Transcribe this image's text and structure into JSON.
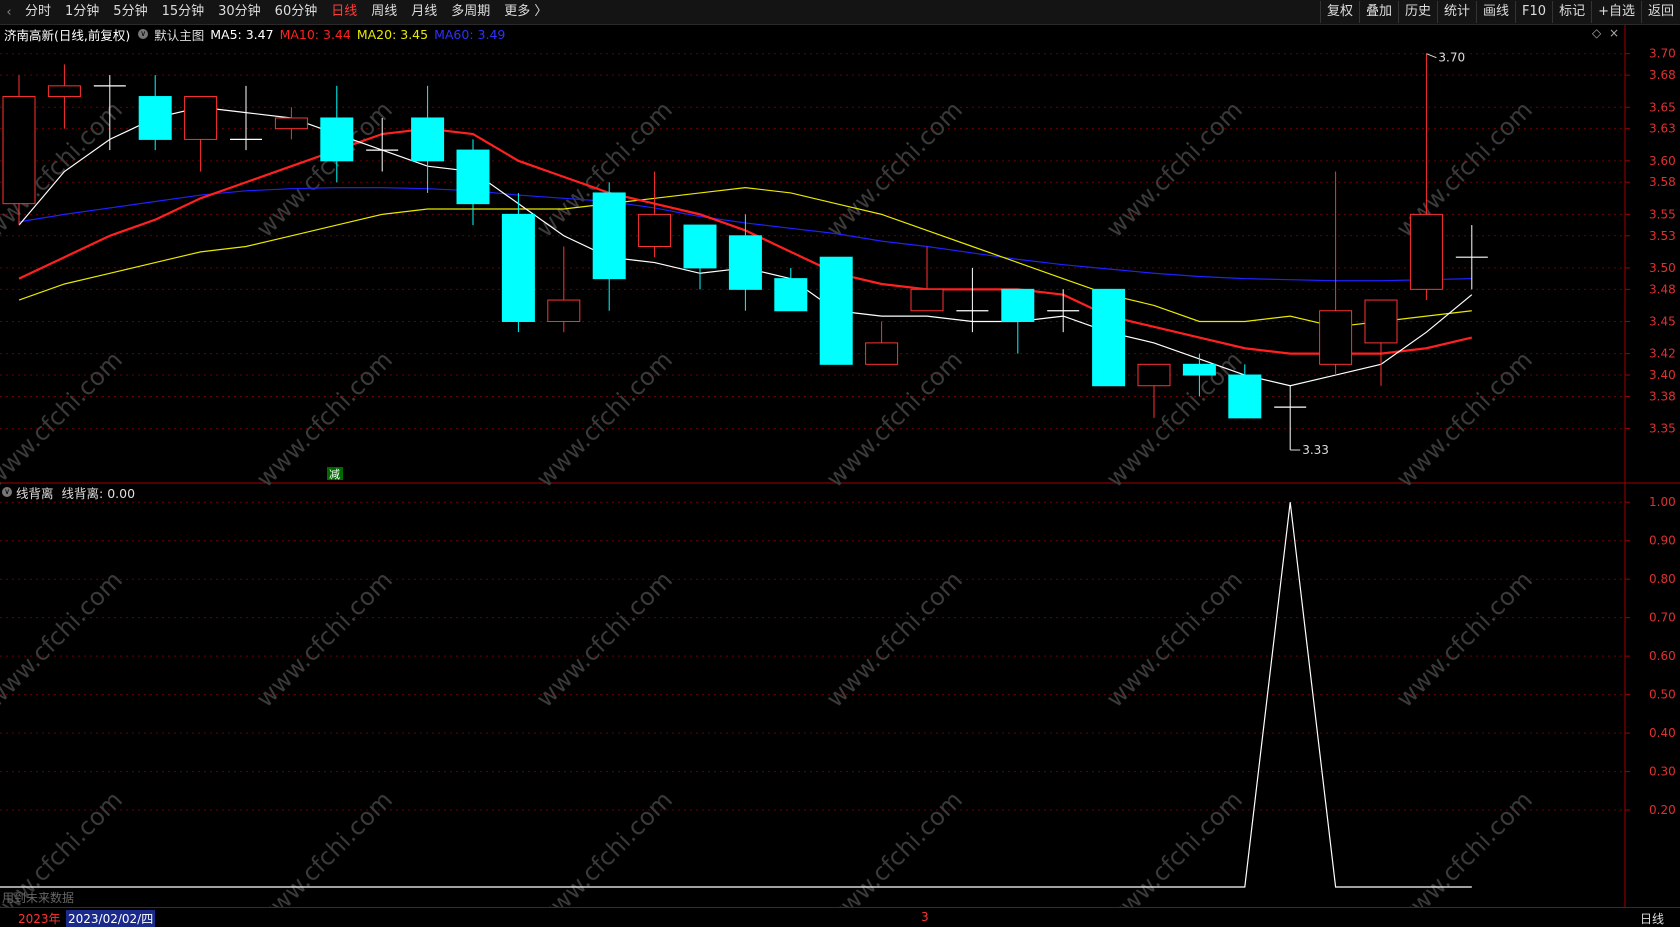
{
  "toolbar": {
    "back_arrow": "‹",
    "periods": [
      "分时",
      "1分钟",
      "5分钟",
      "15分钟",
      "30分钟",
      "60分钟",
      "日线",
      "周线",
      "月线",
      "多周期",
      "更多 〉"
    ],
    "active_period": "日线",
    "right_buttons": [
      "复权",
      "叠加",
      "历史",
      "统计",
      "画线",
      "F10",
      "标记",
      "+自选",
      "返回"
    ]
  },
  "main_info": {
    "stock": "济南高新(日线,前复权)",
    "template": "默认主图",
    "ma5": "MA5: 3.47",
    "ma10": "MA10: 3.44",
    "ma20": "MA20: 3.45",
    "ma60": "MA60: 3.49"
  },
  "sub_info": {
    "indicator": "线背离",
    "value": "线背离: 0.00"
  },
  "markers": {
    "high_label": "3.70",
    "low_label": "3.33",
    "signal": "减",
    "future_note": "用到未来数据"
  },
  "bottom": {
    "year": "2023年",
    "cursor_date": "2023/02/02/四",
    "month_mark": "3",
    "period_label": "日线"
  },
  "price_axis": [
    "3.70",
    "3.68",
    "3.65",
    "3.63",
    "3.60",
    "3.58",
    "3.55",
    "3.53",
    "3.50",
    "3.48",
    "3.45",
    "3.42",
    "3.40",
    "3.38",
    "3.35"
  ],
  "indicator_axis": [
    "1.00",
    "0.90",
    "0.80",
    "0.70",
    "0.60",
    "0.50",
    "0.40",
    "0.30",
    "0.20"
  ],
  "watermark": "www.cfchi.com",
  "colors": {
    "up": "#ff3232",
    "down": "#00ffff",
    "ma5": "#ffffff",
    "ma10": "#ff2020",
    "ma20": "#e8e800",
    "ma60": "#2020ff",
    "axis": "#a00000",
    "active": "#ff3b3b"
  },
  "chart_data": {
    "type": "candlestick",
    "candles": [
      {
        "o": 3.56,
        "h": 3.68,
        "l": 3.54,
        "c": 3.66
      },
      {
        "o": 3.66,
        "h": 3.69,
        "l": 3.63,
        "c": 3.67
      },
      {
        "o": 3.67,
        "h": 3.68,
        "l": 3.61,
        "c": 3.67
      },
      {
        "o": 3.66,
        "h": 3.68,
        "l": 3.61,
        "c": 3.62
      },
      {
        "o": 3.62,
        "h": 3.66,
        "l": 3.59,
        "c": 3.66
      },
      {
        "o": 3.62,
        "h": 3.67,
        "l": 3.61,
        "c": 3.62
      },
      {
        "o": 3.63,
        "h": 3.65,
        "l": 3.62,
        "c": 3.64
      },
      {
        "o": 3.64,
        "h": 3.67,
        "l": 3.58,
        "c": 3.6
      },
      {
        "o": 3.61,
        "h": 3.64,
        "l": 3.59,
        "c": 3.61
      },
      {
        "o": 3.64,
        "h": 3.67,
        "l": 3.57,
        "c": 3.6
      },
      {
        "o": 3.61,
        "h": 3.62,
        "l": 3.54,
        "c": 3.56
      },
      {
        "o": 3.55,
        "h": 3.57,
        "l": 3.44,
        "c": 3.45
      },
      {
        "o": 3.45,
        "h": 3.52,
        "l": 3.44,
        "c": 3.47
      },
      {
        "o": 3.57,
        "h": 3.58,
        "l": 3.46,
        "c": 3.49
      },
      {
        "o": 3.52,
        "h": 3.59,
        "l": 3.51,
        "c": 3.55
      },
      {
        "o": 3.54,
        "h": 3.54,
        "l": 3.48,
        "c": 3.5
      },
      {
        "o": 3.53,
        "h": 3.55,
        "l": 3.46,
        "c": 3.48
      },
      {
        "o": 3.49,
        "h": 3.5,
        "l": 3.46,
        "c": 3.46
      },
      {
        "o": 3.51,
        "h": 3.51,
        "l": 3.41,
        "c": 3.41
      },
      {
        "o": 3.41,
        "h": 3.45,
        "l": 3.41,
        "c": 3.43
      },
      {
        "o": 3.46,
        "h": 3.52,
        "l": 3.46,
        "c": 3.48
      },
      {
        "o": 3.46,
        "h": 3.5,
        "l": 3.44,
        "c": 3.46
      },
      {
        "o": 3.48,
        "h": 3.48,
        "l": 3.42,
        "c": 3.45
      },
      {
        "o": 3.46,
        "h": 3.48,
        "l": 3.44,
        "c": 3.46
      },
      {
        "o": 3.48,
        "h": 3.48,
        "l": 3.39,
        "c": 3.39
      },
      {
        "o": 3.39,
        "h": 3.39,
        "l": 3.36,
        "c": 3.41
      },
      {
        "o": 3.41,
        "h": 3.42,
        "l": 3.38,
        "c": 3.4
      },
      {
        "o": 3.4,
        "h": 3.41,
        "l": 3.36,
        "c": 3.36
      },
      {
        "o": 3.37,
        "h": 3.39,
        "l": 3.33,
        "c": 3.37
      },
      {
        "o": 3.41,
        "h": 3.59,
        "l": 3.4,
        "c": 3.46
      },
      {
        "o": 3.43,
        "h": 3.47,
        "l": 3.39,
        "c": 3.47
      },
      {
        "o": 3.48,
        "h": 3.7,
        "l": 3.47,
        "c": 3.55
      },
      {
        "o": 3.51,
        "h": 3.54,
        "l": 3.48,
        "c": 3.51
      }
    ],
    "ma5": [
      3.54,
      3.59,
      3.62,
      3.64,
      3.65,
      3.645,
      3.64,
      3.625,
      3.61,
      3.595,
      3.59,
      3.56,
      3.53,
      3.51,
      3.505,
      3.495,
      3.5,
      3.49,
      3.46,
      3.455,
      3.455,
      3.45,
      3.45,
      3.455,
      3.44,
      3.43,
      3.415,
      3.4,
      3.39,
      3.4,
      3.41,
      3.44,
      3.475
    ],
    "ma10": [
      3.49,
      3.51,
      3.53,
      3.545,
      3.565,
      3.58,
      3.595,
      3.61,
      3.625,
      3.63,
      3.625,
      3.6,
      3.585,
      3.57,
      3.56,
      3.55,
      3.535,
      3.515,
      3.495,
      3.485,
      3.48,
      3.48,
      3.48,
      3.475,
      3.455,
      3.445,
      3.435,
      3.425,
      3.42,
      3.42,
      3.42,
      3.425,
      3.435
    ],
    "ma20": [
      3.47,
      3.485,
      3.495,
      3.505,
      3.515,
      3.52,
      3.53,
      3.54,
      3.55,
      3.555,
      3.555,
      3.555,
      3.555,
      3.56,
      3.565,
      3.57,
      3.575,
      3.57,
      3.56,
      3.55,
      3.535,
      3.52,
      3.505,
      3.49,
      3.475,
      3.465,
      3.45,
      3.45,
      3.455,
      3.445,
      3.45,
      3.455,
      3.46
    ],
    "ma60": [
      3.543,
      3.55,
      3.556,
      3.562,
      3.568,
      3.572,
      3.574,
      3.575,
      3.575,
      3.574,
      3.572,
      3.568,
      3.565,
      3.562,
      3.556,
      3.548,
      3.542,
      3.537,
      3.532,
      3.525,
      3.52,
      3.514,
      3.508,
      3.503,
      3.499,
      3.495,
      3.492,
      3.49,
      3.489,
      3.488,
      3.488,
      3.489,
      3.49
    ],
    "indicator": [
      0,
      0,
      0,
      0,
      0,
      0,
      0,
      0,
      0,
      0,
      0,
      0,
      0,
      0,
      0,
      0,
      0,
      0,
      0,
      0,
      0,
      0,
      0,
      0,
      0,
      0,
      0,
      0,
      1,
      0,
      0,
      0,
      0
    ],
    "price_range": [
      3.33,
      3.71
    ],
    "indicator_range": [
      0,
      1.05
    ]
  }
}
